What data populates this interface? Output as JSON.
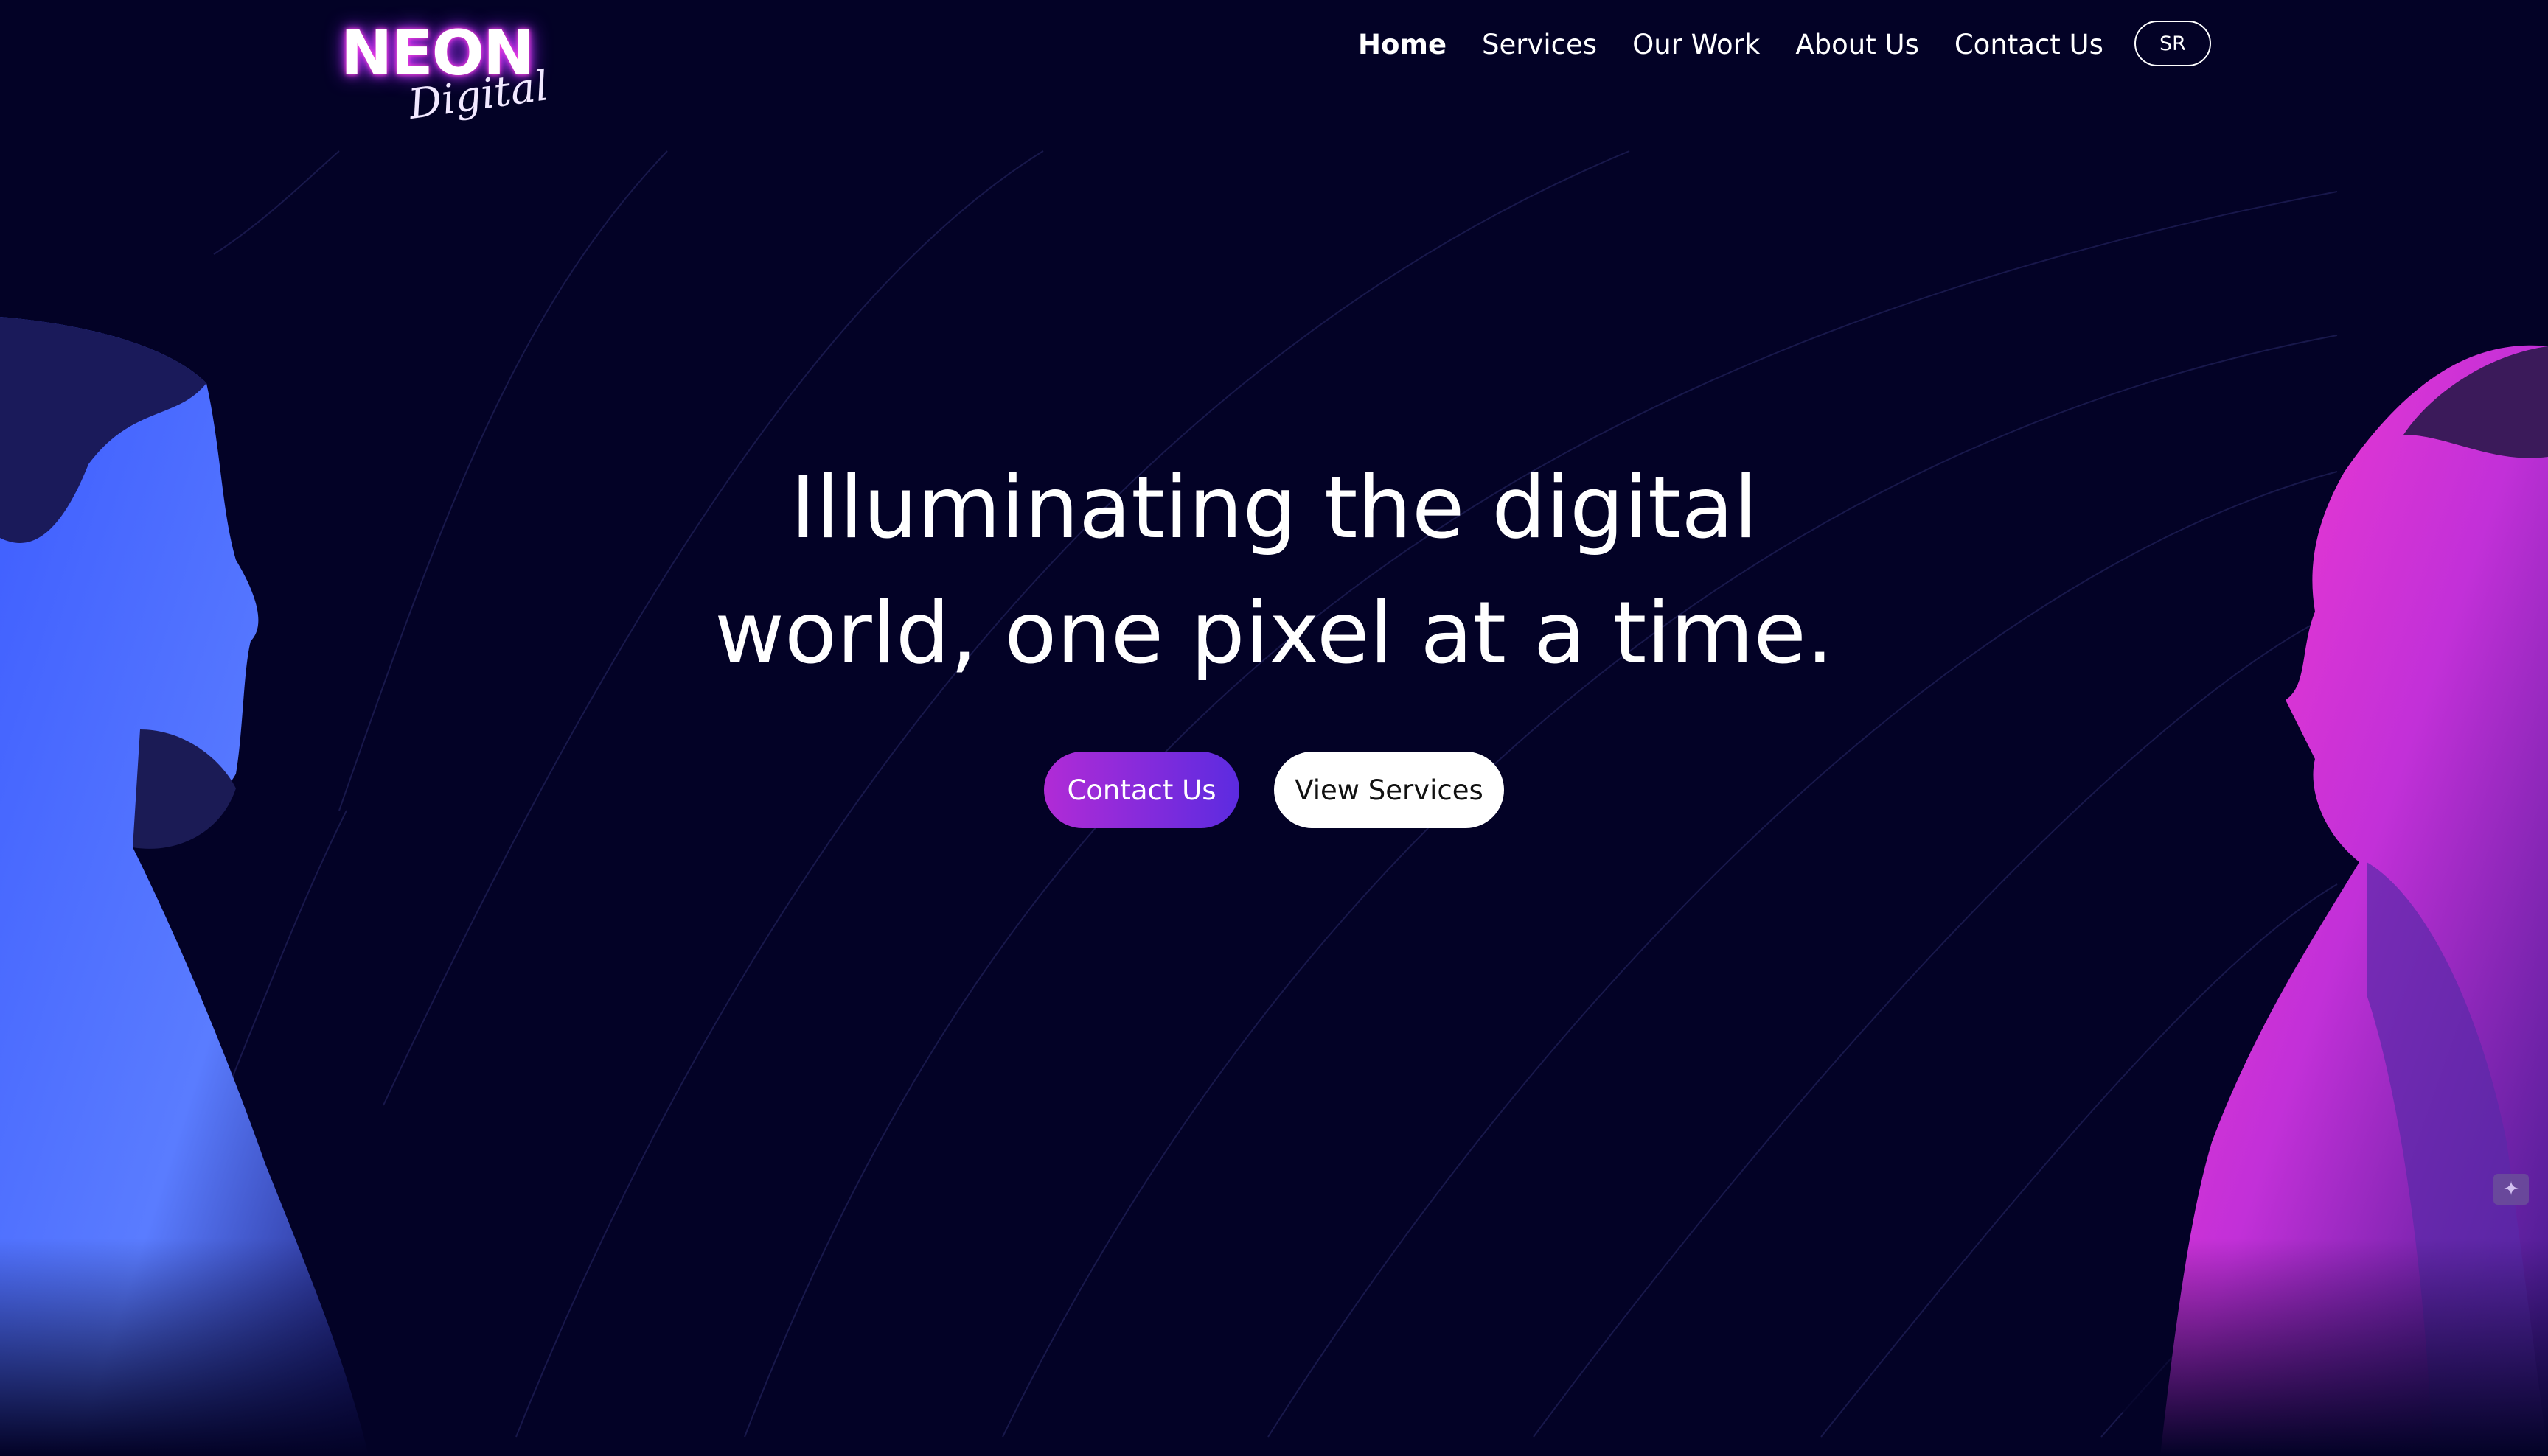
{
  "logo": {
    "wordmark": "NEON",
    "script": "Digital"
  },
  "nav": {
    "items": [
      {
        "label": "Home",
        "active": true
      },
      {
        "label": "Services",
        "active": false
      },
      {
        "label": "Our Work",
        "active": false
      },
      {
        "label": "About Us",
        "active": false
      },
      {
        "label": "Contact Us",
        "active": false
      }
    ],
    "language_button": "SR"
  },
  "hero": {
    "title_line1": "Illuminating the digital",
    "title_line2": "world, one pixel at a time.",
    "primary_button": "Contact Us",
    "secondary_button": "View Services"
  },
  "colors": {
    "background": "#030226",
    "accent_gradient_start": "#b12bd6",
    "accent_gradient_end": "#5c2be0",
    "neon_glow": "#d63cff"
  },
  "icons": {
    "sparkle": "sparkle-icon"
  }
}
